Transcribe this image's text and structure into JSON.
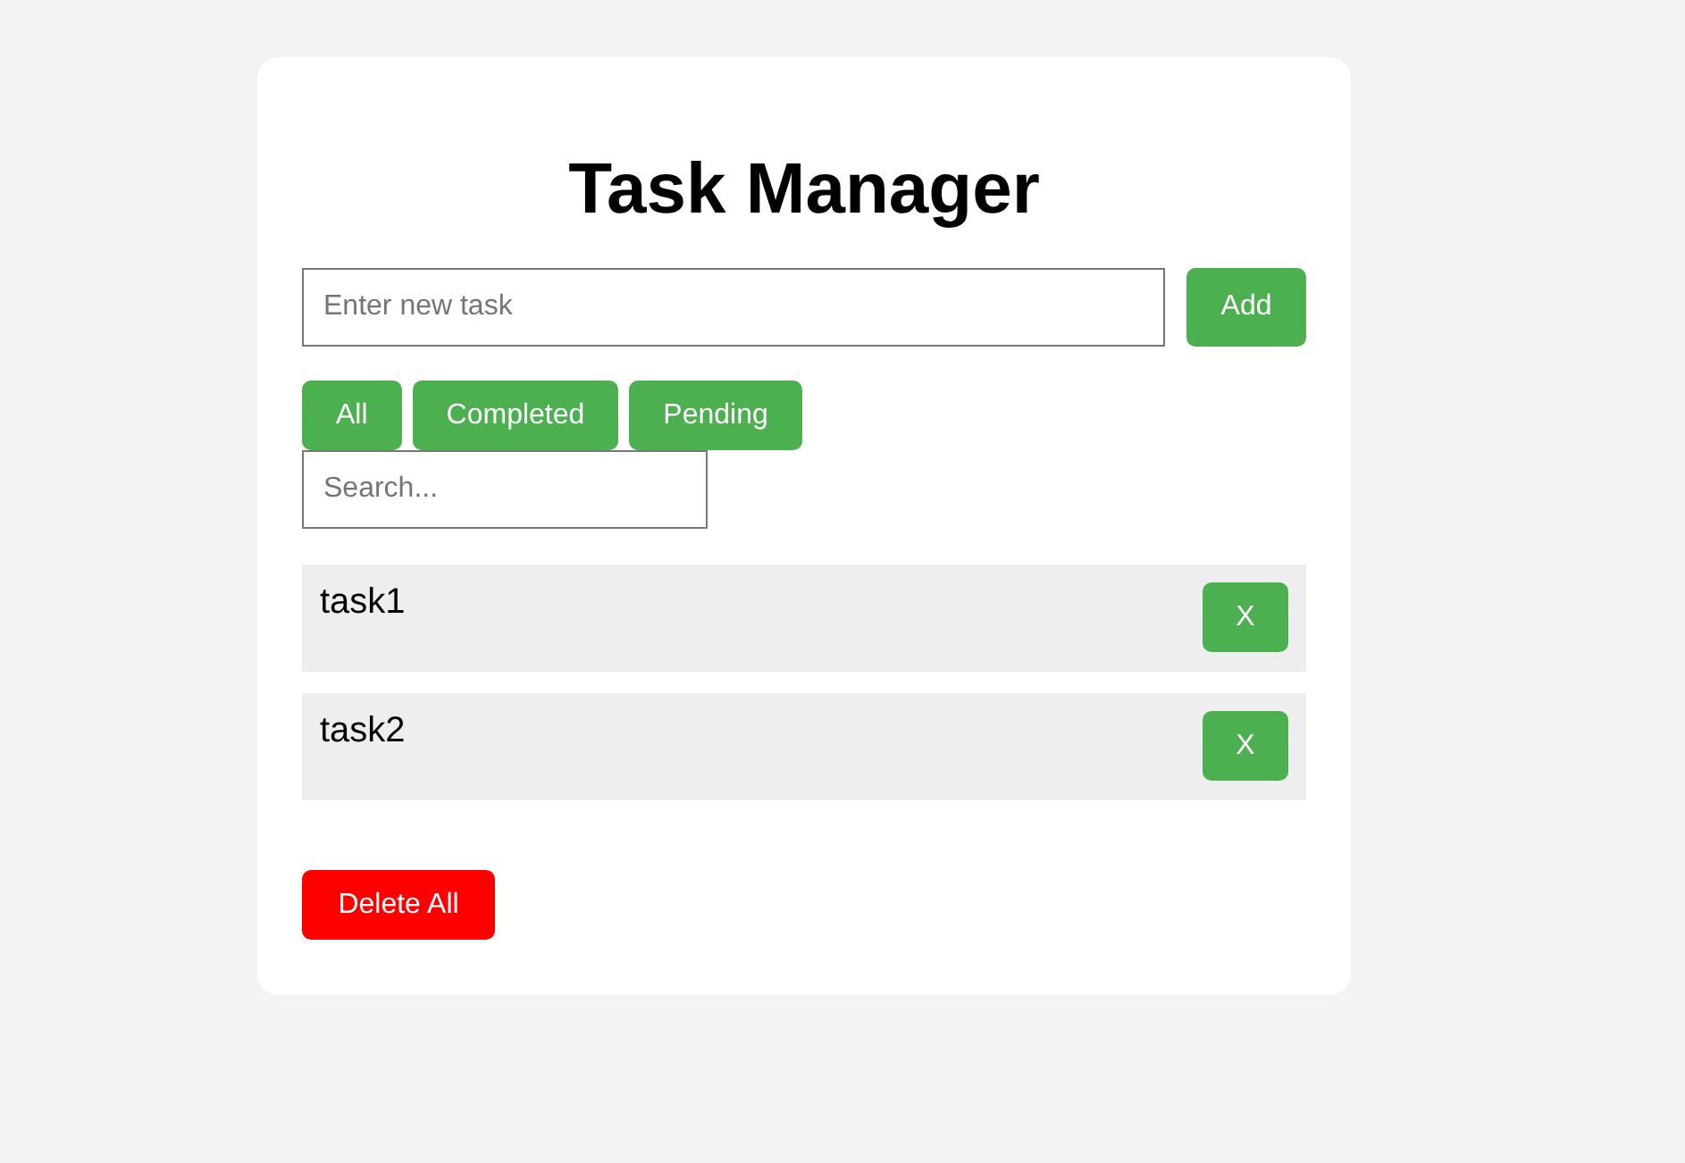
{
  "title": "Task Manager",
  "new_task": {
    "placeholder": "Enter new task"
  },
  "add_button": "Add",
  "filters": [
    "All",
    "Completed",
    "Pending"
  ],
  "search": {
    "placeholder": "Search..."
  },
  "tasks": [
    {
      "text": "task1",
      "delete_label": "X"
    },
    {
      "text": "task2",
      "delete_label": "X"
    }
  ],
  "delete_all_button": "Delete All"
}
